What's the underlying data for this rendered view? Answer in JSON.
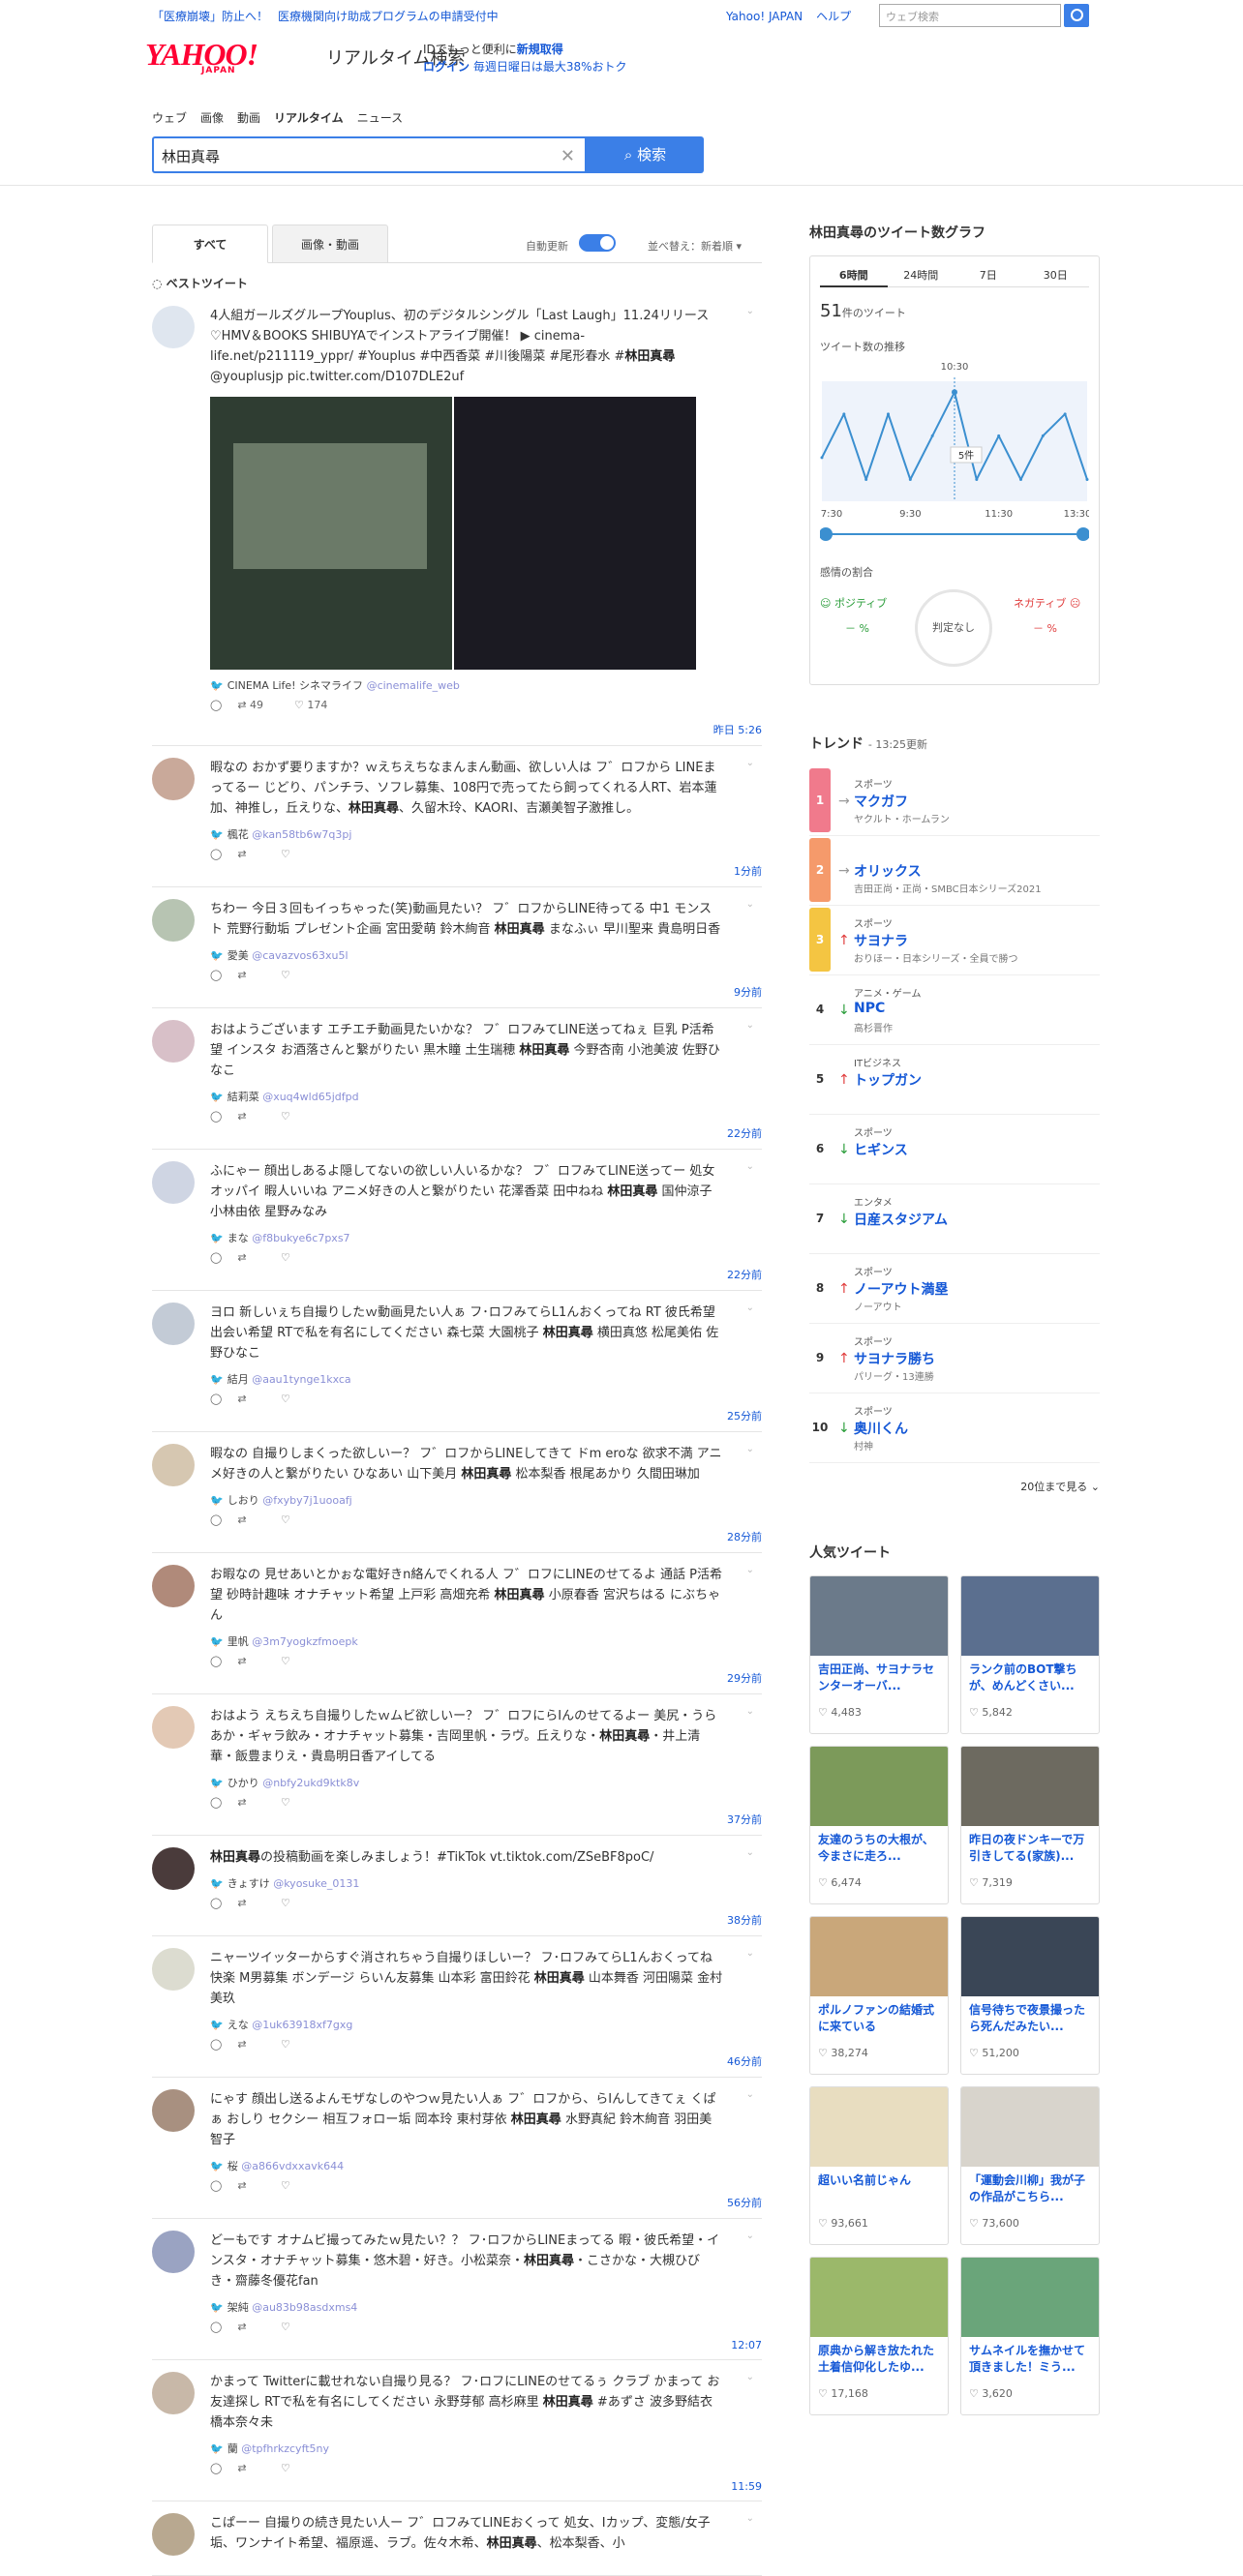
{
  "topbar": {
    "link1": "「医療崩壊」防止へ！",
    "link2": "医療機関向け助成プログラムの申請受付中",
    "yahoo": "Yahoo! JAPAN",
    "help": "ヘルプ",
    "search_placeholder": "ウェブ検索"
  },
  "brand": {
    "logo": "YAHOO!",
    "logo_sub": "JAPAN",
    "title": "リアルタイム検索"
  },
  "promo": {
    "line1": "IDでもっと便利に",
    "signup": "新規取得",
    "login": "ログイン",
    "line2": "毎週日曜日は最大38%おトク"
  },
  "nav": [
    "ウェブ",
    "画像",
    "動画",
    "リアルタイム",
    "ニュース"
  ],
  "search": {
    "value": "林田真尋",
    "button": "検索"
  },
  "tabs": {
    "all": "すべて",
    "media": "画像・動画",
    "auto": "自動更新",
    "sort": "並べ替え：新着順"
  },
  "best_label": "ベストツイート",
  "tweets": [
    {
      "text": "4人組ガールズグループYouplus、初のデジタルシングル「Last Laugh」11.24リリース ♡HMV＆BOOKS SHIBUYAでインストアライブ開催！ ▶ cinema-life.net/p211119_yppr/ #Youplus #中西香菜 #川後陽菜 #尾形春水 #林田真尋 @youplusjp pic.twitter.com/D107DLE2uf",
      "user": "CINEMA Life! シネマライフ",
      "handle": "@cinemalife_web",
      "rt": "49",
      "fav": "174",
      "time": "昨日 5:26"
    },
    {
      "text": "暇なの おかず要りますか？ｗえちえちなまんまん動画、欲しい人は フ゛ロフから LINEまってるー じどり、パンチラ、ソフレ募集、108円で売ってたら飼ってくれる人RT、岩本蓮加、神推し，丘えりな、林田真尋、久留木玲、KAORI、吉瀬美智子激推し。",
      "user": "楓花",
      "handle": "@kan58tb6w7q3pj",
      "time": "1分前"
    },
    {
      "text": "ちわー 今日３回もイっちゃった(笑)動画見たい？ フ゛ロフからLINE待ってる 中1 モンスト 荒野行動垢 プレゼント企画 宮田愛萌 鈴木絢音 林田真尋 まなふぃ 早川聖来 貴島明日香",
      "user": "愛美",
      "handle": "@cavazvos63xu5l",
      "time": "9分前"
    },
    {
      "text": "おはようございます エチエチ動画見たいかな？ フ゛ロフみてLINE送ってねぇ 巨乳 P活希望 インスタ お酒落さんと繋がりたい 黒木瞳 土生瑞穂 林田真尋 今野杏南 小池美波 佐野ひなこ",
      "user": "結莉菜",
      "handle": "@xuq4wld65jdfpd",
      "time": "22分前"
    },
    {
      "text": "ふにゃー 顔出しあるよ隠してないの欲しい人いるかな？ フ゛ロフみてLINE送ってー 処女 オッパイ 暇人いいね アニメ好きの人と繋がりたい 花澤香菜 田中ねね 林田真尋 国仲涼子 小林由依 星野みなみ",
      "user": "まな",
      "handle": "@f8bukye6c7pxs7",
      "time": "22分前"
    },
    {
      "text": "ヨロ 新しいぇち自撮りしたｗ動画見たい人ぁ フ･ロフみてらL1んおくってね RT 彼氏希望 出会い希望 RTで私を有名にしてください 森七菜 大園桃子 林田真尋 横田真悠 松尾美佑 佐野ひなこ",
      "user": "結月",
      "handle": "@aau1tynge1kxca",
      "time": "25分前"
    },
    {
      "text": "暇なの 自撮りしまくった欲しいー？ フ゛ロフからLINEしてきて ドm eroな 欲求不満 アニメ好きの人と繋がりたい ひなあい 山下美月 林田真尋 松本梨香 根尾あかり 久間田琳加",
      "user": "しおり",
      "handle": "@fxyby7j1uooafj",
      "time": "28分前"
    },
    {
      "text": "お暇なの 見せあいとかぉな電好きn絡んでくれる人 フ゛ロフにLINEのせてるよ 通話 P活希望 砂時計趣味 オナチャット希望 上戸彩 高畑充希 林田真尋 小原春香 宮沢ちはる にぶちゃん",
      "user": "里帆",
      "handle": "@3m7yogkzfmoepk",
      "time": "29分前"
    },
    {
      "text": "おはよう えちえち自撮りしたｗムビ欲しいー？ フ゛ロフにらIんのせてるよー 美尻・うらあか・ギャラ飲み・オナチャット募集・吉岡里帆・ラヴ。丘えりな・林田真尋・井上清華・飯豊まりえ・貴島明日香アイしてる",
      "user": "ひかり",
      "handle": "@nbfy2ukd9ktk8v",
      "time": "37分前"
    },
    {
      "text": "林田真尋の投稿動画を楽しみましょう！#TikTok vt.tiktok.com/ZSeBF8poC/",
      "user": "きょすけ",
      "handle": "@kyosuke_0131",
      "time": "38分前"
    },
    {
      "text": "ニャーツイッターからすぐ消されちゃう自撮りほしいー？ フ･ロフみてらL1んおくってね 快楽 M男募集 ボンデージ らいん友募集 山本彩 富田鈴花 林田真尋 山本舞香 河田陽菜 金村美玖",
      "user": "えな",
      "handle": "@1uk63918xf7gxg",
      "time": "46分前"
    },
    {
      "text": "にゃす 顔出し送るよんモザなしのやつｗ見たい人ぁ フ゛ロフから、らIんしてきてぇ くぱぁ おしり セクシー 相互フォロー垢 岡本玲 東村芽依 林田真尋 水野真紀 鈴木絢音 羽田美智子",
      "user": "桜",
      "handle": "@a866vdxxavk644",
      "time": "56分前"
    },
    {
      "text": "どーもです オナムビ撮ってみたｗ見たい？？ フ･ロフからLINEまってる 暇・彼氏希望・インスタ・オナチャット募集・悠木碧・好き。小松菜奈・林田真尋・こさかな・大槻ひびき・齋藤冬優花fan",
      "user": "架純",
      "handle": "@au83b98asdxms4",
      "time": "12:07"
    },
    {
      "text": "かまって Twitterに載せれない自撮り見る？ フ･ロフにLINEのせてるぅ クラブ かまって お友達探し RTで私を有名にしてください 永野芽郁 高杉麻里 林田真尋 #あずさ 波多野結衣 橋本奈々未",
      "user": "蘭",
      "handle": "@tpfhrkzcyft5ny",
      "time": "11:59"
    },
    {
      "text": "こぱーー 自撮りの続き見たい人ー フ゛ロフみてLINEおくって 処女、Iカップ、変態/女子垢、ワンナイト希望、福原遥、ラブ。佐々木希、林田真尋、松本梨香、小",
      "user": "",
      "handle": "",
      "time": ""
    }
  ],
  "graph": {
    "title": "林田真尋のツイート数グラフ",
    "tabs": [
      "6時間",
      "24時間",
      "7日",
      "30日"
    ],
    "count": "51",
    "count_suffix": "件のツイート",
    "trend_label": "ツイート数の推移",
    "peak_time": "10:30",
    "peak_value": "5件",
    "xlabels": [
      "7:30",
      "9:30",
      "11:30",
      "13:30"
    ],
    "sentiment": "感情の割合",
    "pos": "ポジティブ",
    "neg": "ネガティブ",
    "neutral": "判定なし",
    "pos_val": "－ %",
    "neg_val": "－ %"
  },
  "chart_data": {
    "type": "line",
    "title": "ツイート数の推移",
    "x": [
      "7:30",
      "8:00",
      "8:30",
      "9:00",
      "9:30",
      "10:00",
      "10:30",
      "11:00",
      "11:30",
      "12:00",
      "12:30",
      "13:00",
      "13:30"
    ],
    "series": [
      {
        "values": [
          2,
          4,
          1,
          4,
          1,
          3,
          5,
          1,
          3,
          1,
          3,
          4,
          1
        ]
      }
    ]
  },
  "trend": {
    "title": "トレンド",
    "updated": "13:25更新",
    "more": "20位まで見る",
    "items": [
      {
        "rank": "1",
        "cat": "スポーツ",
        "name": "マクガフ",
        "sub": "ヤクルト・ホームラン",
        "arrow": "→",
        "color": "#f07a8c"
      },
      {
        "rank": "2",
        "cat": "",
        "name": "オリックス",
        "sub": "吉田正尚・正尚・SMBC日本シリーズ2021",
        "arrow": "→",
        "color": "#f59a6b"
      },
      {
        "rank": "3",
        "cat": "スポーツ",
        "name": "サヨナラ",
        "sub": "おりほー・日本シリーズ・全員で勝つ",
        "arrow": "↑",
        "color": "#f4c542"
      },
      {
        "rank": "4",
        "cat": "アニメ・ゲーム",
        "name": "NPC",
        "sub": "高杉晋作",
        "arrow": "↓",
        "color": ""
      },
      {
        "rank": "5",
        "cat": "ITビジネス",
        "name": "トップガン",
        "sub": "",
        "arrow": "↑",
        "color": ""
      },
      {
        "rank": "6",
        "cat": "スポーツ",
        "name": "ヒギンス",
        "sub": "",
        "arrow": "↓",
        "color": ""
      },
      {
        "rank": "7",
        "cat": "エンタメ",
        "name": "日産スタジアム",
        "sub": "",
        "arrow": "↓",
        "color": ""
      },
      {
        "rank": "8",
        "cat": "スポーツ",
        "name": "ノーアウト満塁",
        "sub": "ノーアウト",
        "arrow": "↑",
        "color": ""
      },
      {
        "rank": "9",
        "cat": "スポーツ",
        "name": "サヨナラ勝ち",
        "sub": "パリーグ・13連勝",
        "arrow": "↑",
        "color": ""
      },
      {
        "rank": "10",
        "cat": "スポーツ",
        "name": "奥川くん",
        "sub": "村神",
        "arrow": "↓",
        "color": ""
      }
    ]
  },
  "popular": {
    "title": "人気ツイート",
    "items": [
      {
        "text": "吉田正尚、サヨナラセンターオーバ...",
        "likes": "4,483",
        "c": "#6b7a8a"
      },
      {
        "text": "ランク前のBOT撃ちが、めんどくさい...",
        "likes": "5,842",
        "c": "#5b6f8f"
      },
      {
        "text": "友達のうちの大根が、今まさに走ろ...",
        "likes": "6,474",
        "c": "#7c9a5a"
      },
      {
        "text": "昨日の夜ドンキーで万引きしてる(家族)...",
        "likes": "7,319",
        "c": "#6d6a60"
      },
      {
        "text": "ポルノファンの結婚式に来ている",
        "likes": "38,274",
        "c": "#c9a77a"
      },
      {
        "text": "信号待ちで夜景撮ったら死んだみたい...",
        "likes": "51,200",
        "c": "#3a4656"
      },
      {
        "text": "超いい名前じゃん",
        "likes": "93,661",
        "c": "#e8ddc0"
      },
      {
        "text": "「運動会川柳」我が子の作品がこちら...",
        "likes": "73,600",
        "c": "#d8d4cc"
      },
      {
        "text": "原典から解き放たれた土着信仰化したゆ...",
        "likes": "17,168",
        "c": "#9bb86a"
      },
      {
        "text": "サムネイルを撫かせて頂きました！ミう...",
        "likes": "3,620",
        "c": "#6aa57a"
      }
    ]
  }
}
